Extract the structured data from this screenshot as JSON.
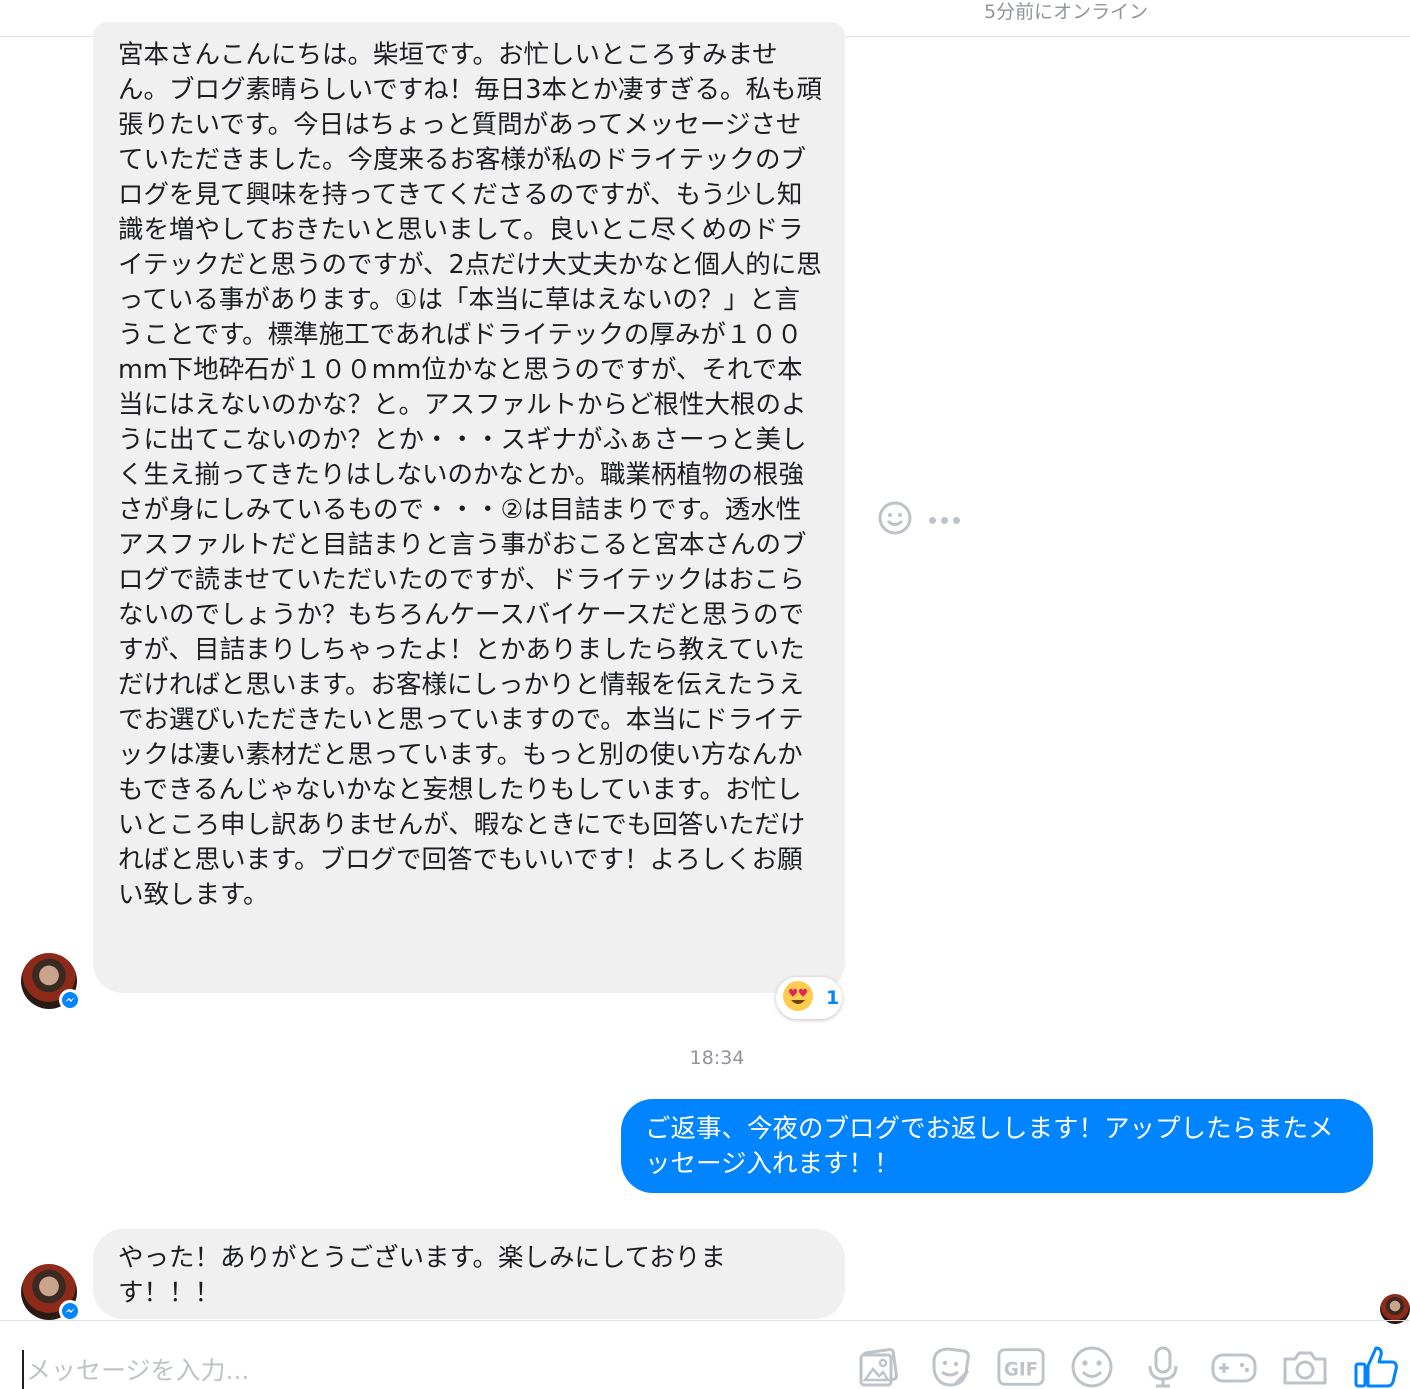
{
  "header": {
    "status": "5分前にオンライン"
  },
  "messages": {
    "incoming_long": "宮本さんこんにちは。柴垣です。お忙しいところすみません。ブログ素晴らしいですね！毎日3本とか凄すぎる。私も頑張りたいです。今日はちょっと質問があってメッセージさせていただきました。今度来るお客様が私のドライテックのブログを見て興味を持ってきてくださるのですが、もう少し知識を増やしておきたいと思いまして。良いとこ尽くめのドライテックだと思うのですが、2点だけ大丈夫かなと個人的に思っている事があります。①は「本当に草はえないの？」と言うことです。標準施工であればドライテックの厚みが１００mm下地砕石が１００mm位かなと思うのですが、それで本当にはえないのかな？と。アスファルトからど根性大根のように出てこないのか？とか・・・スギナがふぁさーっと美しく生え揃ってきたりはしないのかなとか。職業柄植物の根強さが身にしみているもので・・・②は目詰まりです。透水性アスファルトだと目詰まりと言う事がおこると宮本さんのブログで読ませていただいたのですが、ドライテックはおこらないのでしょうか？もちろんケースバイケースだと思うのですが、目詰まりしちゃったよ！とかありましたら教えていただければと思います。お客様にしっかりと情報を伝えたうえでお選びいただきたいと思っていますので。本当にドライテックは凄い素材だと思っています。もっと別の使い方なんかもできるんじゃないかなと妄想したりもしています。お忙しいところ申し訳ありませんが、暇なときにでも回答いただければと思います。ブログで回答でもいいです！よろしくお願い致します。",
    "reaction_emoji": "heart-eyes-icon",
    "reaction_count": "1",
    "timestamp": "18:34",
    "outgoing": "ご返事、今夜のブログでお返しします！アップしたらまたメッセージ入れます！！",
    "incoming_short": "やった！ありがとうございます。楽しみにしております！！！"
  },
  "composer": {
    "placeholder": "メッセージを入力..."
  },
  "toolbar": {
    "items": [
      "image-icon",
      "sticker-icon",
      "gif-icon",
      "emoji-icon",
      "microphone-icon",
      "game-controller-icon",
      "camera-icon",
      "thumbs-up-icon"
    ],
    "gif_label": "GIF"
  },
  "colors": {
    "accent": "#0084ff",
    "incoming_bubble": "#f1f0f0",
    "muted_text": "#90949c",
    "icon_gray": "#bec3c9"
  }
}
